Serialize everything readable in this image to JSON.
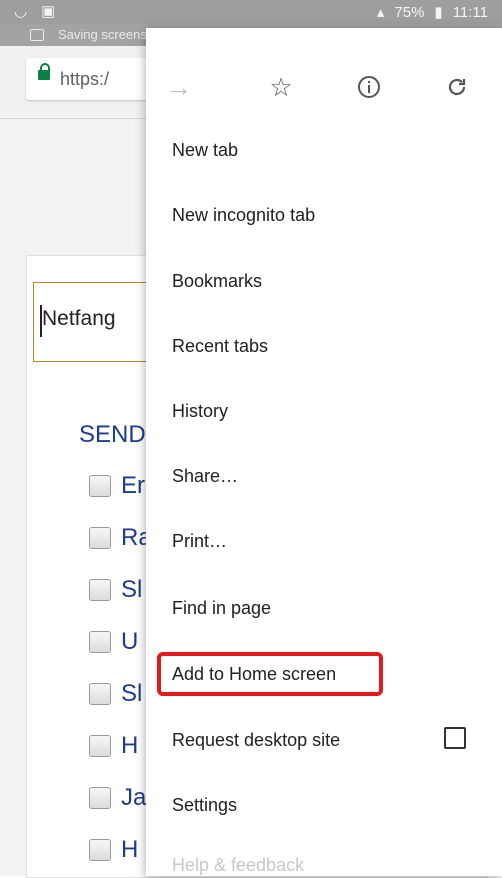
{
  "status_bar": {
    "battery": "75%",
    "time": "11:11",
    "notification": "Saving screenshot..."
  },
  "toolbar": {
    "url_text": "https:/"
  },
  "page": {
    "field_value": "Netfang",
    "section_heading": "SEND",
    "checkbox_items": [
      "Er",
      "Ra",
      "Sl",
      "U",
      "Sl",
      "H",
      "Ja",
      "H"
    ]
  },
  "menu": {
    "icons": [
      "forward-icon",
      "star-icon",
      "info-icon",
      "refresh-icon"
    ],
    "items": [
      {
        "label": "New tab"
      },
      {
        "label": "New incognito tab"
      },
      {
        "label": "Bookmarks"
      },
      {
        "label": "Recent tabs"
      },
      {
        "label": "History"
      },
      {
        "label": "Share…"
      },
      {
        "label": "Print…"
      },
      {
        "label": "Find in page"
      },
      {
        "label": "Add to Home screen"
      },
      {
        "label": "Request desktop site"
      },
      {
        "label": "Settings"
      },
      {
        "label": "Help & feedback"
      }
    ],
    "highlight_color": "#e11a1a"
  }
}
